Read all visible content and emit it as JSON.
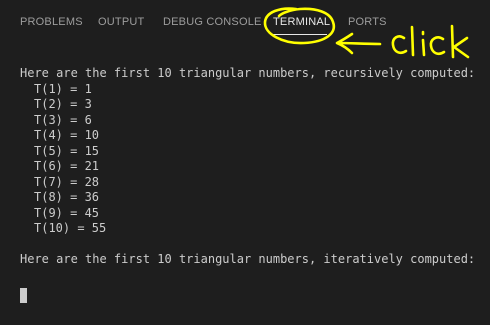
{
  "tabs": [
    {
      "label": "PROBLEMS"
    },
    {
      "label": "OUTPUT"
    },
    {
      "label": "DEBUG CONSOLE"
    },
    {
      "label": "TERMINAL",
      "active": true
    },
    {
      "label": "PORTS"
    }
  ],
  "annotation": {
    "text": "click",
    "color": "#ffff00"
  },
  "terminal": {
    "header_recursive": "Here are the first 10 triangular numbers, recursively computed:",
    "lines": [
      "T(1) = 1",
      "T(2) = 3",
      "T(3) = 6",
      "T(4) = 10",
      "T(5) = 15",
      "T(6) = 21",
      "T(7) = 28",
      "T(8) = 36",
      "T(9) = 45",
      "T(10) = 55"
    ],
    "header_iterative": "Here are the first 10 triangular numbers, iteratively computed:"
  },
  "colors": {
    "background": "#1e1e1e",
    "text": "#cccccc",
    "tab_inactive": "#9d9d9d",
    "tab_active": "#e7e7e7"
  }
}
